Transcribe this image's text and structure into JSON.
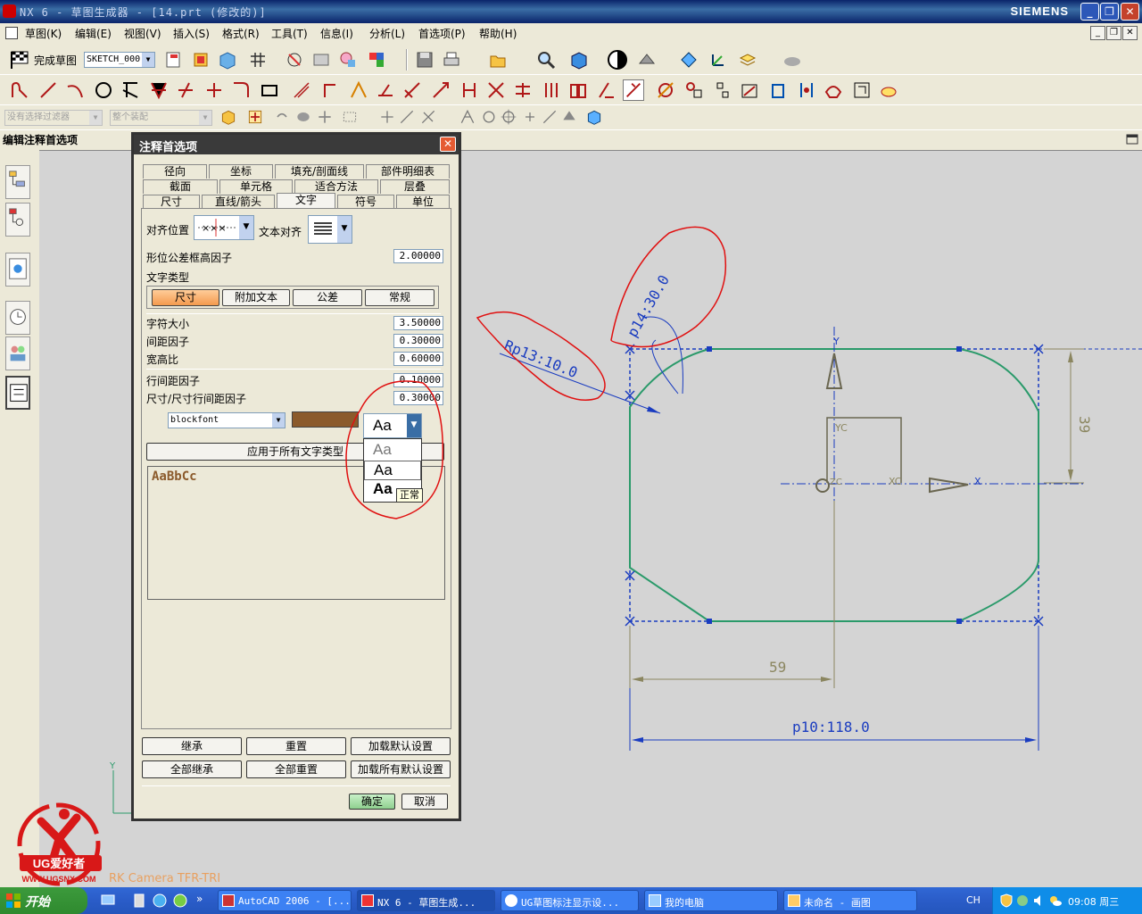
{
  "window": {
    "title": "NX 6 - 草图生成器 - [14.prt (修改的)]",
    "brand": "SIEMENS"
  },
  "menu": [
    "草图(K)",
    "编辑(E)",
    "视图(V)",
    "插入(S)",
    "格式(R)",
    "工具(T)",
    "信息(I)",
    "分析(L)",
    "首选项(P)",
    "帮助(H)"
  ],
  "toolbar": {
    "finish_sketch": "完成草图",
    "sketch_name": "SKETCH_000",
    "filter_placeholder": "没有选择过滤器",
    "scope": "整个装配"
  },
  "strip_title": "编辑注释首选项",
  "dialog": {
    "title": "注释首选项",
    "tabs_row1": [
      "径向",
      "坐标",
      "填充/剖面线",
      "部件明细表"
    ],
    "tabs_row2": [
      "截面",
      "单元格",
      "适合方法",
      "层叠"
    ],
    "tabs_row3": [
      "尺寸",
      "直线/箭头",
      "文字",
      "符号",
      "单位"
    ],
    "active_tab": "文字",
    "align_position_label": "对齐位置",
    "text_align_label": "文本对齐",
    "gdt_frame_label": "形位公差框高因子",
    "gdt_frame_value": "2.00000",
    "text_type_label": "文字类型",
    "text_types": [
      "尺寸",
      "附加文本",
      "公差",
      "常规"
    ],
    "active_text_type": "尺寸",
    "char_size_label": "字符大小",
    "char_size_value": "3.50000",
    "spacing_label": "间距因子",
    "spacing_value": "0.30000",
    "aspect_label": "宽高比",
    "aspect_value": "0.60000",
    "line_spacing_label": "行间距因子",
    "line_spacing_value": "0.10000",
    "dim_line_spacing_label": "尺寸/尺寸行间距因子",
    "dim_line_spacing_value": "0.30000",
    "font": "blockfont",
    "font_color": "#8b5a2b",
    "style_options": [
      "Aa",
      "Aa",
      "Aa"
    ],
    "style_tooltip": "正常",
    "apply_all_label": "应用于所有文字类型",
    "preview_text": "AaBbCc",
    "inherit_label": "继承",
    "reset_label": "重置",
    "load_default_label": "加载默认设置",
    "inherit_all_label": "全部继承",
    "reset_all_label": "全部重置",
    "load_all_default_label": "加载所有默认设置",
    "ok_label": "确定",
    "cancel_label": "取消"
  },
  "drawing": {
    "dim_width_inner": "59",
    "dim_width_total": "p10:118.0",
    "dim_height": "39",
    "radius1": "Rp13:10.0",
    "radius2": "p14:30.0",
    "axis_y": "Y",
    "axis_yc": "YC",
    "axis_xc": "XC",
    "axis_x": "X",
    "origin_label": "ZC",
    "wcs_y": "Y",
    "camera_text": "RK Camera TFR-TRI",
    "watermark_text": "UG爱好者",
    "watermark_url": "WWW.UGSNX.COM"
  },
  "taskbar": {
    "start": "开始",
    "tasks": [
      "AutoCAD 2006 - [...",
      "NX 6 - 草图生成...",
      "UG草图标注显示设...",
      "我的电脑",
      "未命名 - 画图"
    ],
    "active_task": 1,
    "lang": "CH",
    "time": "09:08 周三"
  }
}
